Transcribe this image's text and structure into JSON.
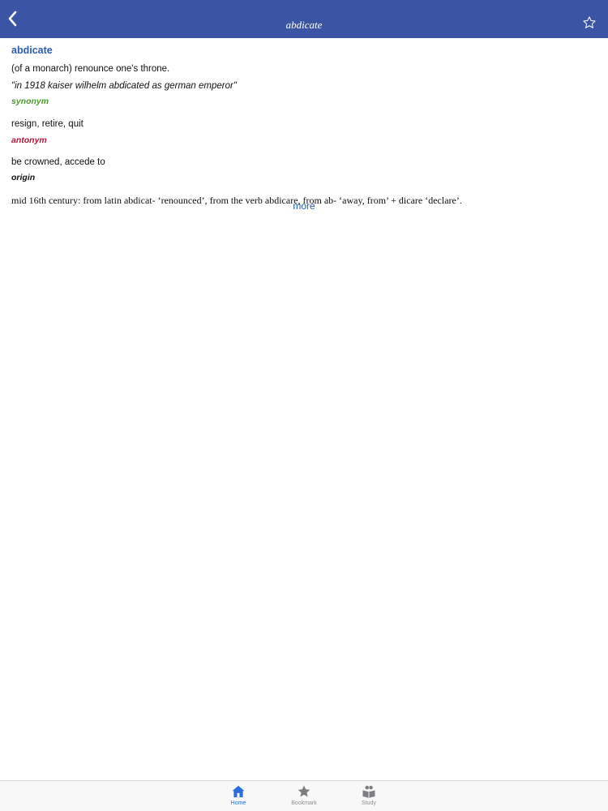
{
  "navbar": {
    "title": "abdicate",
    "back_icon": "chevron-left-icon",
    "bookmark_icon": "star-outline-icon"
  },
  "entry": {
    "headword": "abdicate",
    "definition": "(of a monarch) renounce one's throne.",
    "example": "\"in 1918 kaiser wilhelm abdicated as german emperor\"",
    "synonym_label": "synonym",
    "synonyms": "resign, retire, quit",
    "antonym_label": "antonym",
    "antonyms": "be crowned, accede to",
    "origin_label": "origin",
    "origin": "mid 16th century: from latin abdicat- ‘renounced’, from the verb abdicare, from ab- ‘away, from’ + dicare ‘declare’."
  },
  "more_label": "more",
  "tabbar": {
    "tabs": [
      {
        "label": "Home",
        "icon": "home-icon",
        "active": true
      },
      {
        "label": "Bookmark",
        "icon": "star-icon",
        "active": false
      },
      {
        "label": "Study",
        "icon": "study-icon",
        "active": false
      }
    ]
  },
  "colors": {
    "navbar": "#3b55a4",
    "headword": "#2a5db0",
    "synonym": "#4a9e2c",
    "antonym": "#b0173a",
    "tab_active": "#2a6fdb",
    "tab_inactive": "#8e8e93"
  }
}
